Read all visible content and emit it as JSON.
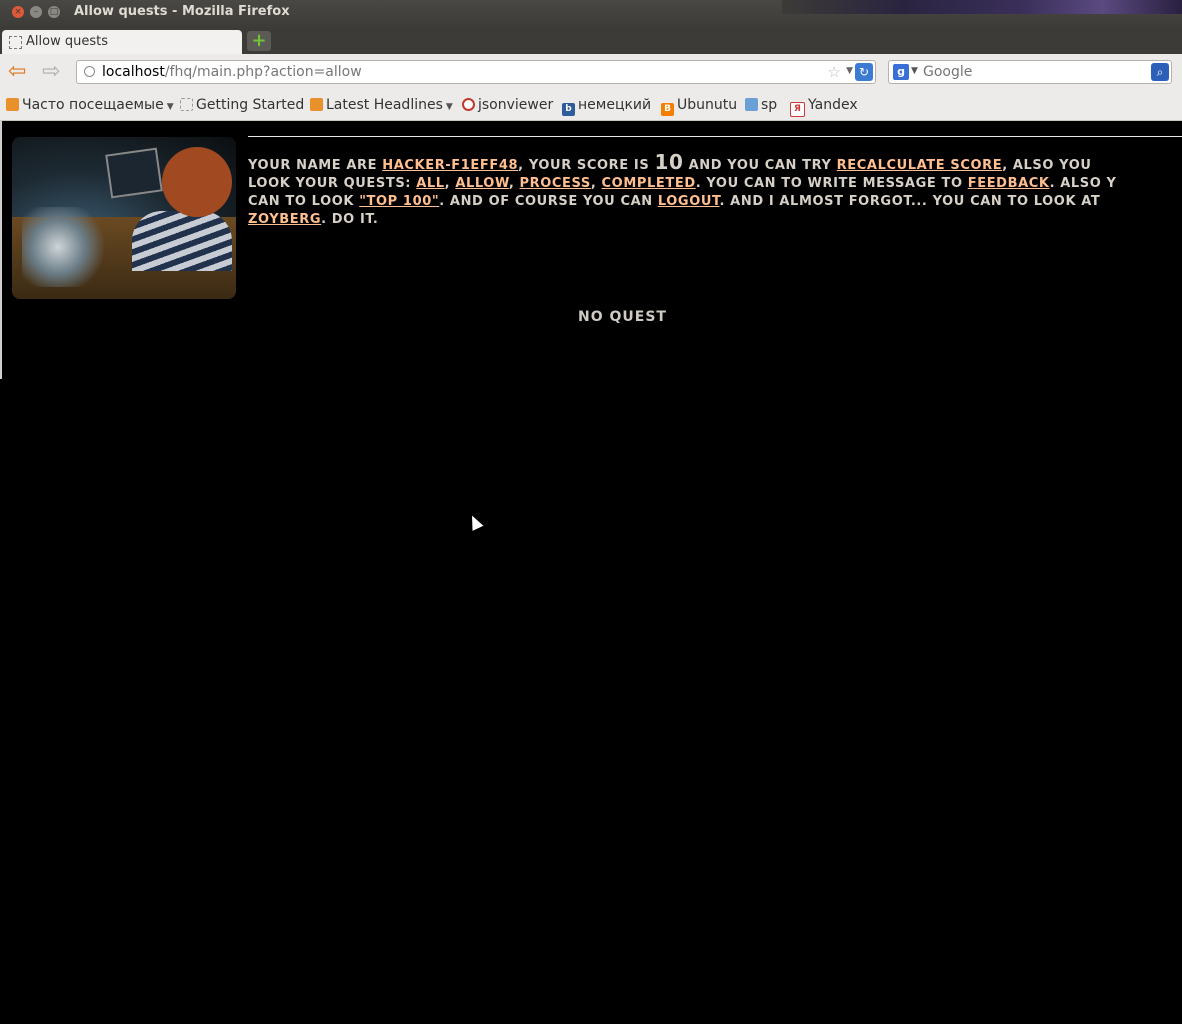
{
  "window": {
    "title": "Allow quests - Mozilla Firefox"
  },
  "tab": {
    "label": "Allow quests"
  },
  "nav": {
    "url_host": "localhost",
    "url_path": "/fhq/main.php?action=allow",
    "search_placeholder": "Google"
  },
  "bookmarks": [
    {
      "label": "Часто посещаемые",
      "icon": "rss-folder-icon",
      "color": "#e8902a"
    },
    {
      "label": "Getting Started",
      "icon": "page-icon",
      "color": "#999999"
    },
    {
      "label": "Latest Headlines",
      "icon": "rss-icon",
      "color": "#e8902a"
    },
    {
      "label": "jsonviewer",
      "icon": "jsonviewer-icon",
      "color": "#c0392b"
    },
    {
      "label": "немецкий",
      "icon": "b-icon",
      "color": "#2d5d9b"
    },
    {
      "label": "Ubunutu",
      "icon": "blogger-icon",
      "color": "#f57d00"
    },
    {
      "label": "sp",
      "icon": "sp-icon",
      "color": "#6aa0d6"
    },
    {
      "label": "Yandex",
      "icon": "yandex-icon",
      "color": "#d03a3a"
    }
  ],
  "page": {
    "t1": "Your name are ",
    "username": "hacker-f1eff48",
    "t2": ", your score is ",
    "score": "10",
    "t3": " and you can try ",
    "recalc": "recalculate score",
    "t4": ", also you",
    "t5": "look your quests: ",
    "all": "all",
    "c1": ", ",
    "allow": "allow",
    "c2": ", ",
    "process": "process",
    "c3": ", ",
    "completed": "completed",
    "t6": ". You can to write message to ",
    "feedback": "feedback",
    "t7": ". Also y",
    "t8": "can to look ",
    "top100": "\"top 100\"",
    "t9": ". And of course you can ",
    "logout": "logout",
    "t10": ". And I almost forgot... you can to look at",
    "zoyberg": "zoyberg",
    "t11": ". Do it.",
    "no_quest": "No Quest"
  }
}
